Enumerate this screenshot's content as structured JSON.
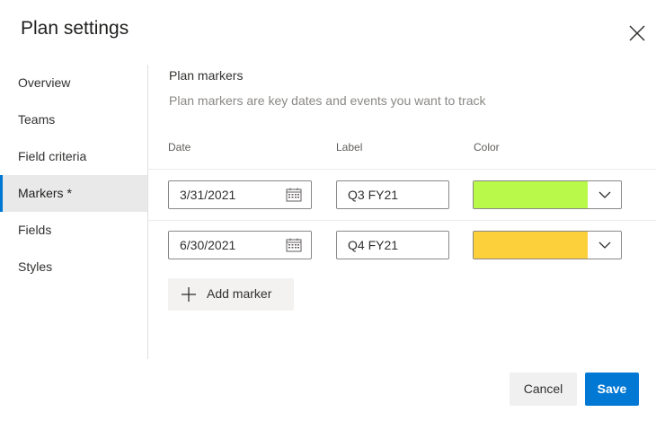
{
  "dialog": {
    "title": "Plan settings",
    "close_icon": "close-icon"
  },
  "nav": {
    "items": [
      {
        "label": "Overview",
        "selected": false
      },
      {
        "label": "Teams",
        "selected": false
      },
      {
        "label": "Field criteria",
        "selected": false
      },
      {
        "label": "Markers *",
        "selected": true
      },
      {
        "label": "Fields",
        "selected": false
      },
      {
        "label": "Styles",
        "selected": false
      }
    ]
  },
  "markers": {
    "title": "Plan markers",
    "description": "Plan markers are key dates and events you want to track",
    "columns": {
      "date": "Date",
      "label": "Label",
      "color": "Color"
    },
    "rows": [
      {
        "date": "3/31/2021",
        "label": "Q3 FY21",
        "color": "#b9f94a"
      },
      {
        "date": "6/30/2021",
        "label": "Q4 FY21",
        "color": "#fcd03b"
      }
    ],
    "add_label": "Add marker"
  },
  "footer": {
    "cancel_label": "Cancel",
    "save_label": "Save",
    "accent_color": "#0078d4"
  }
}
